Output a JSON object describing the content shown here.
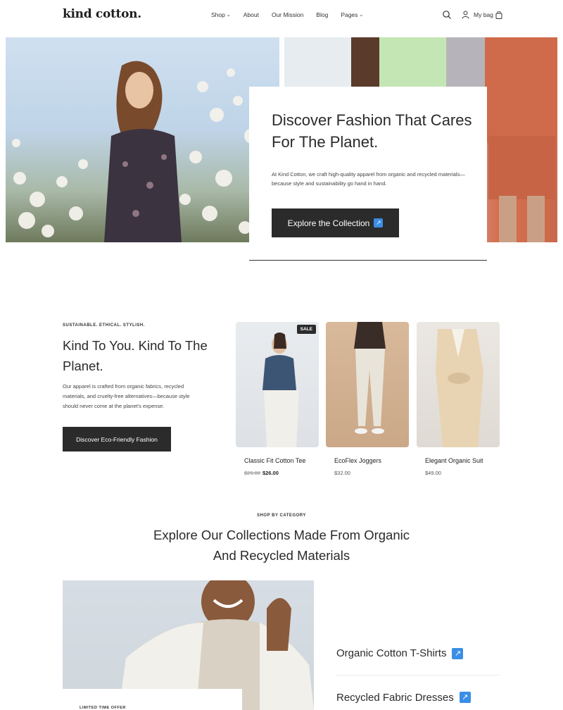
{
  "header": {
    "logo": "kind cotton.",
    "nav": [
      "Shop",
      "About",
      "Our Mission",
      "Blog",
      "Pages"
    ],
    "bag_label": "My bag"
  },
  "hero": {
    "title": "Discover Fashion That Cares For The Planet.",
    "text": "At Kind Cotton, we craft high-quality apparel from organic and recycled materials—because style and sustainability go hand in hand.",
    "button": "Explore the Collection"
  },
  "intro": {
    "eyebrow": "SUSTAINABLE. ETHICAL. STYLISH.",
    "title": "Kind To You. Kind To The Planet.",
    "text": "Our apparel is crafted from organic fabrics, recycled materials, and cruelty-free alternatives—because style should never come at the planet's expense.",
    "button": "Discover Eco-Friendly Fashion"
  },
  "products": [
    {
      "name": "Classic Fit Cotton Tee",
      "old_price": "$29.00",
      "price": "$26.00",
      "badge": "SALE"
    },
    {
      "name": "EcoFlex Joggers",
      "price": "$32.00"
    },
    {
      "name": "Elegant Organic Suit",
      "price": "$49.00"
    }
  ],
  "categories": {
    "eyebrow": "SHOP BY CATEGORY",
    "title": "Explore Our Collections Made From Organic And Recycled Materials",
    "offer_label": "LIMITED TIME OFFER",
    "items": [
      "Organic Cotton T-Shirts",
      "Recycled Fabric Dresses"
    ]
  },
  "colors": {
    "dark": "#2b2b2b",
    "accent_arrow": "#3a8ee6"
  },
  "icons": [
    "search-icon",
    "user-icon",
    "bag-icon",
    "arrow-up-right-icon",
    "chevron-down-icon"
  ]
}
